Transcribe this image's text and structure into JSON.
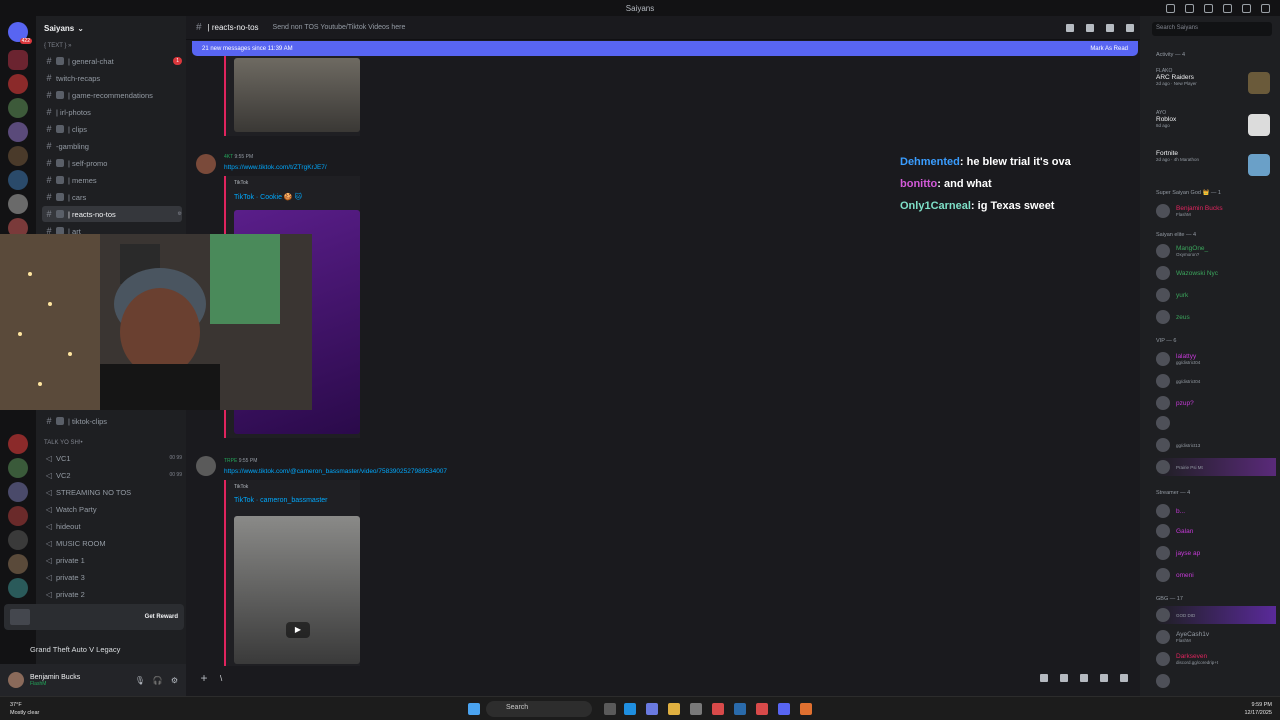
{
  "window": {
    "title": "Saiyans"
  },
  "server": {
    "name": "Saiyans"
  },
  "channels": [
    {
      "label": "{ Text } »",
      "kind": "cat"
    },
    {
      "label": "| general-chat",
      "unread": "1"
    },
    {
      "label": "twitch-recaps"
    },
    {
      "label": "| game-recommendations"
    },
    {
      "label": "| irl-photos"
    },
    {
      "label": "| clips"
    },
    {
      "label": "-gambling"
    },
    {
      "label": "| self-promo"
    },
    {
      "label": "| memes"
    },
    {
      "label": "| cars"
    },
    {
      "label": "| reacts-no-tos",
      "active": true
    },
    {
      "label": "| art"
    },
    {
      "label": "| tiktok-clips"
    }
  ],
  "voice_category": "TALK YO SH!•",
  "voice": [
    {
      "label": "VC1",
      "count": "00  99"
    },
    {
      "label": "VC2",
      "count": "00  99"
    },
    {
      "label": "STREAMING NO TOS"
    },
    {
      "label": "Watch Party"
    },
    {
      "label": "hideout"
    },
    {
      "label": "MUSIC ROOM"
    },
    {
      "label": "private 1"
    },
    {
      "label": "private 3"
    },
    {
      "label": "private 2"
    }
  ],
  "promo": {
    "label": "Get Reward"
  },
  "activity": {
    "game": "Grand Theft Auto V Legacy"
  },
  "user": {
    "name": "Benjamin Bucks",
    "status": "FlashM"
  },
  "channel_header": {
    "name": "| reacts-no-tos",
    "topic": "Send non TOS Youtube/Tiktok Videos here"
  },
  "new_messages": {
    "text": "21 new messages since 11:39 AM",
    "action": "Mark As Read"
  },
  "messages": [
    {
      "time": "9:55 PM",
      "tag": "4KT",
      "link": "https://www.tiktok.com/t/ZTrgKrJE7/",
      "provider": "TikTok",
      "title": "TikTok · Cookie 🍪 🐱"
    },
    {
      "time": "9:55 PM",
      "tag": "TRPE",
      "link": "https://www.tiktok.com/@cameron_bassmaster/video/7583902527989534007",
      "provider": "TikTok",
      "title": "TikTok · cameron_bassmaster"
    }
  ],
  "chat_overlay": [
    {
      "user": "Dehmented",
      "text": ": he blew trial it's ova",
      "color": "#3a9dff"
    },
    {
      "user": "bonitto",
      "text": ": and what",
      "color": "#d25ad8"
    },
    {
      "user": "Only1Carneal",
      "text": ": ig Texas sweet",
      "color": "#7ee0c8"
    }
  ],
  "composer": {
    "value": "\\"
  },
  "members": {
    "search_placeholder": "Search Saiyans",
    "activity_header": "Activity — 4",
    "activities": [
      {
        "user": "FLAKO",
        "game": "ARC Raiders",
        "meta": "2d ago  · New Player"
      },
      {
        "user": "AYO",
        "game": "Roblox",
        "meta": "8d ago"
      },
      {
        "user": "",
        "game": "Fortnite",
        "meta": "2d ago  · 4h Marathon"
      }
    ],
    "groups": [
      {
        "header": "Super Saiyan God 👑 — 1",
        "items": [
          {
            "name": "Benjamin Bucks",
            "sub": "FlashM",
            "color": "#e0245e"
          }
        ]
      },
      {
        "header": "Saiyan elite — 4",
        "items": [
          {
            "name": "MangOne_",
            "sub": "Oxymoron?",
            "color": "#3ba55c"
          },
          {
            "name": "Wazowski Nyc",
            "sub": "",
            "color": "#3ba55c"
          },
          {
            "name": "yurk",
            "sub": "",
            "color": "#3ba55c"
          },
          {
            "name": "zeus",
            "sub": "",
            "color": "#3ba55c"
          }
        ]
      },
      {
        "header": "VIP — 6",
        "items": [
          {
            "name": "lalattyy",
            "sub": "gg/district04",
            "color": "#c63ad8"
          },
          {
            "name": "",
            "sub": "gg/district04",
            "color": "#c63ad8"
          },
          {
            "name": "pzup?",
            "sub": "",
            "color": "#c63ad8"
          },
          {
            "name": "",
            "sub": "",
            "color": "#c63ad8"
          },
          {
            "name": "",
            "sub": "gg/district13",
            "color": "#c63ad8"
          },
          {
            "name": "",
            "sub": "Prairie Psi Mt",
            "color": "#c63ad8"
          }
        ]
      },
      {
        "header": "Streamer — 4",
        "items": [
          {
            "name": "b...",
            "sub": "",
            "color": "#c63ad8"
          },
          {
            "name": "Galan",
            "sub": "",
            "color": "#c63ad8"
          },
          {
            "name": "jayse ap",
            "sub": "",
            "color": "#c63ad8"
          },
          {
            "name": "omeni",
            "sub": "",
            "color": "#c63ad8"
          }
        ]
      },
      {
        "header": "GBG — 17",
        "items": [
          {
            "name": "",
            "sub": "GOD DID",
            "color": "#c63ad8"
          },
          {
            "name": "AyeCash1v",
            "sub": "FlashM",
            "color": "#949ba4"
          },
          {
            "name": "Darkseven",
            "sub": "discord.gg/coredrip+t",
            "color": "#e0245e"
          },
          {
            "name": "",
            "sub": "",
            "color": "#949ba4"
          }
        ]
      }
    ]
  },
  "taskbar": {
    "search": "Search",
    "weather": "37°F",
    "weather_sub": "Mostly clear",
    "time": "9:59 PM",
    "date": "12/17/2025"
  },
  "colors": {
    "accent": "#5865f2",
    "embed_bar": "#e0245e",
    "link": "#00a8fc"
  }
}
